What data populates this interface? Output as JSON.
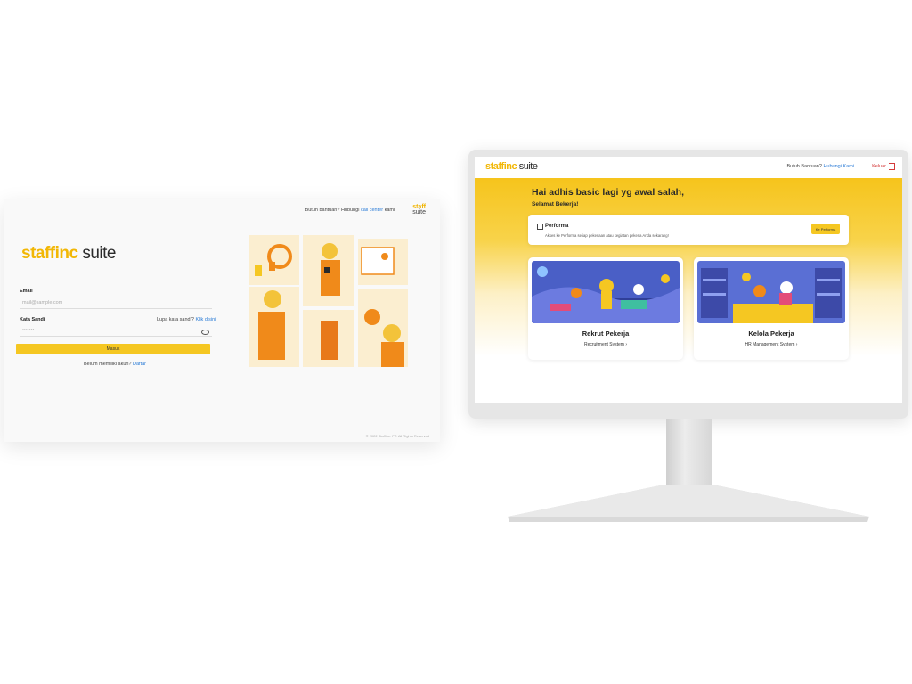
{
  "login": {
    "help_text": "Butuh bantuan? Hubungi",
    "help_link": "call center",
    "help_suffix": "kami",
    "mini_logo_top": "staff",
    "mini_logo_bottom": "suite",
    "brand_staff": "staff",
    "brand_inc": "inc",
    "brand_suite": "suite",
    "email_label": "Email",
    "email_placeholder": "mail@sample.com",
    "password_label": "Kata Sandi",
    "password_value": "•••••••",
    "forgot_text": "Lupa kata sandi?",
    "forgot_link": "Klik disini",
    "submit_label": "Masuk",
    "register_text": "Belum memiliki akun?",
    "register_link": "Daftar",
    "copyright": "© 2022 Staffinc. PT. All Rights Reserved"
  },
  "dashboard": {
    "brand_staff": "staff",
    "brand_inc": "inc",
    "brand_suite": "suite",
    "help_text": "Butuh Bantuan?",
    "help_link": "Hubungi Kami",
    "logout_label": "Keluar",
    "greeting": "Hai adhis basic lagi yg awal salah,",
    "greeting_sub": "Selamat Bekerja!",
    "performa": {
      "title": "Performa",
      "description": "Akses ke Performa setiap pekerjaan atau kegiatan pekerja Anda sekarang!",
      "button": "Ke Performa"
    },
    "modules": [
      {
        "title": "Rekrut Pekerja",
        "link": "Recruitment System"
      },
      {
        "title": "Kelola Pekerja",
        "link": "HR Management System"
      }
    ]
  },
  "colors": {
    "accent": "#f5c722",
    "link": "#2a7bd6",
    "logout": "#d43a3a"
  }
}
